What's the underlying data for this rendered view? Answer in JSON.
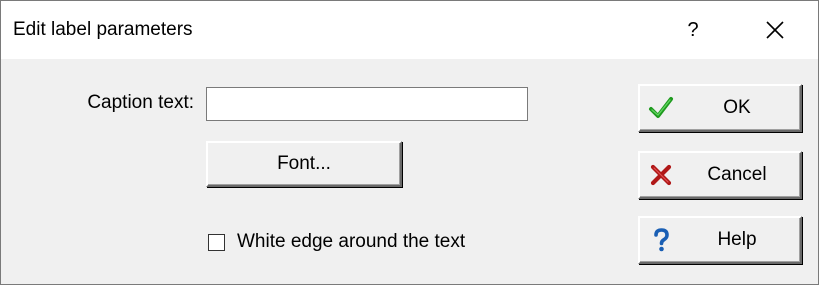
{
  "window": {
    "title": "Edit label parameters",
    "help_glyph": "?",
    "close_icon": "close-icon"
  },
  "form": {
    "caption_label": "Caption text:",
    "caption_value": "",
    "caption_placeholder": "",
    "font_button_label": "Font...",
    "checkbox_label": "White edge around the text",
    "checkbox_checked": false
  },
  "buttons": {
    "ok": {
      "label": "OK",
      "icon": "checkmark-icon",
      "color": "#1e9a1e"
    },
    "cancel": {
      "label": "Cancel",
      "icon": "red-x-icon",
      "color": "#b01818"
    },
    "help": {
      "label": "Help",
      "icon": "question-mark-icon",
      "color": "#1a5fb4"
    }
  },
  "colors": {
    "dialog_bg": "#f0f0f0",
    "titlebar_bg": "#ffffff",
    "border": "#7a7a7a"
  }
}
